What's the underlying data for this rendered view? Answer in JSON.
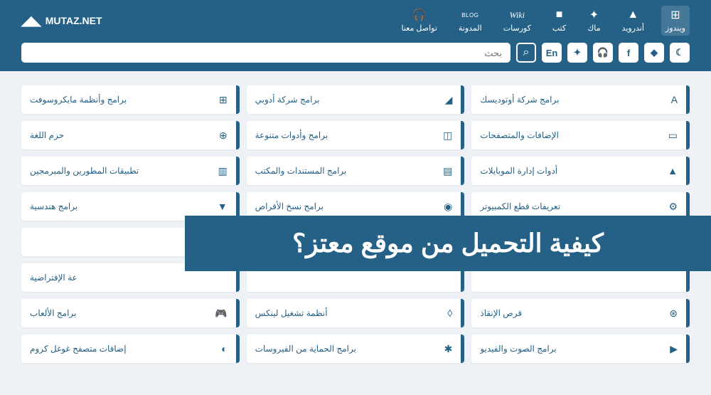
{
  "brand": "MUTAZ.NET",
  "nav": [
    {
      "label": "ويندوز",
      "icon": "⊞",
      "active": true
    },
    {
      "label": "أندرويد",
      "icon": "▲"
    },
    {
      "label": "ماك",
      "icon": "✦"
    },
    {
      "label": "كتب",
      "icon": "■"
    },
    {
      "label": "كورسات",
      "icon": "Wiki"
    },
    {
      "label": "المدونة",
      "icon": "BLOG"
    },
    {
      "label": "تواصل معنا",
      "icon": "🎧"
    }
  ],
  "tools": {
    "dark": "☾",
    "diamond": "◆",
    "facebook": "f",
    "support": "🎧",
    "shuffle": "✦",
    "lang": "En"
  },
  "search": {
    "placeholder": "بحث",
    "icon": "⌕"
  },
  "categories": [
    {
      "label": "برامج شركة أوتوديسك",
      "icon": "A"
    },
    {
      "label": "برامج شركة أدوبي",
      "icon": "◢"
    },
    {
      "label": "برامج وأنظمة مايكروسوفت",
      "icon": "⊞"
    },
    {
      "label": "الإضافات والمتصفحات",
      "icon": "▭"
    },
    {
      "label": "برامج وأدوات متنوعة",
      "icon": "◫"
    },
    {
      "label": "حزم اللغة",
      "icon": "⊕"
    },
    {
      "label": "أدوات إدارة الموبايلات",
      "icon": "▲"
    },
    {
      "label": "برامج المستندات والمكتب",
      "icon": "▤"
    },
    {
      "label": "تطبيقات المطورين والمبرمجين",
      "icon": "▥"
    },
    {
      "label": "تعريفات قطع الكمبيوتر",
      "icon": "⚙"
    },
    {
      "label": "برامج نسخ الأقراص",
      "icon": "◉"
    },
    {
      "label": "برامج هندسية",
      "icon": "▼"
    },
    {
      "label": "",
      "icon": ""
    },
    {
      "label": "",
      "icon": ""
    },
    {
      "label": "",
      "icon": ""
    },
    {
      "label": "",
      "icon": ""
    },
    {
      "label": "",
      "icon": ""
    },
    {
      "label": "عة الإفتراضية",
      "icon": ""
    },
    {
      "label": "قرص الإنقاذ",
      "icon": "⊛"
    },
    {
      "label": "أنظمة تشغيل لينكس",
      "icon": "◊"
    },
    {
      "label": "برامج الألعاب",
      "icon": "🎮"
    },
    {
      "label": "برامج الصوت والفيديو",
      "icon": "▶"
    },
    {
      "label": "برامج الحماية من الفيروسات",
      "icon": "✱"
    },
    {
      "label": "إضافات متصفح غوغل كروم",
      "icon": "◐"
    }
  ],
  "overlay": {
    "text": "كيفية التحميل من موقع معتز؟"
  }
}
